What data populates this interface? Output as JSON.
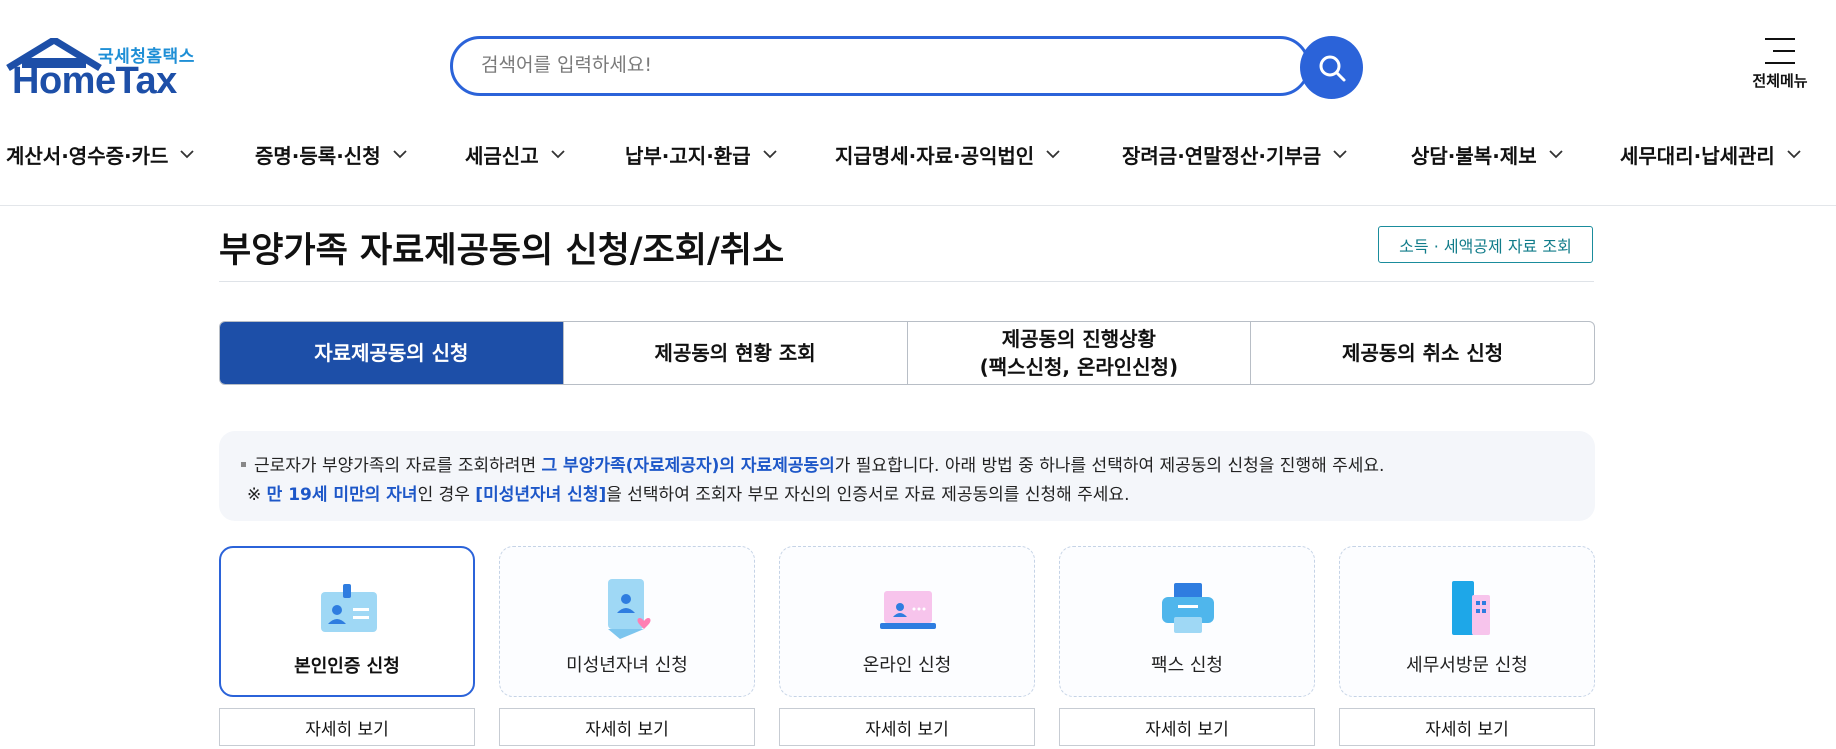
{
  "header": {
    "logo_ko": "국세청홈택스",
    "logo_en": "HomeTax",
    "search_placeholder": "검색어를 입력하세요!",
    "menu_label": "전체메뉴"
  },
  "gnb": [
    {
      "label": "계산서·영수증·카드"
    },
    {
      "label": "증명·등록·신청"
    },
    {
      "label": "세금신고"
    },
    {
      "label": "납부·고지·환급"
    },
    {
      "label": "지급명세·자료·공익법인"
    },
    {
      "label": "장려금·연말정산·기부금"
    },
    {
      "label": "상담·불복·제보"
    },
    {
      "label": "세무대리·납세관리"
    }
  ],
  "page": {
    "title": "부양가족 자료제공동의 신청/조회/취소",
    "side_link": "소득 · 세액공제 자료 조회"
  },
  "tabs": [
    {
      "label": "자료제공동의 신청"
    },
    {
      "label": "제공동의 현황 조회"
    },
    {
      "label": "제공동의 진행상황\n(팩스신청, 온라인신청)"
    },
    {
      "label": "제공동의 취소 신청"
    }
  ],
  "notice": {
    "l1_a": "근로자가 부양가족의 자료를 조회하려면 ",
    "l1_b": "그 부양가족(자료제공자)의 자료제공동의",
    "l1_c": "가 필요합니다. 아래 방법 중 하나를 선택하여 제공동의 신청을 진행해 주세요.",
    "l2_a": "※ ",
    "l2_b": "만 19세 미만의 자녀",
    "l2_c": "인 경우 ",
    "l2_d": "[미성년자녀 신청]",
    "l2_e": "을 선택하여 조회자 부모 자신의 인증서로 자료 제공동의를 신청해 주세요."
  },
  "methods": [
    {
      "label": "본인인증 신청",
      "detail": "자세히 보기",
      "icon": "id-card-icon"
    },
    {
      "label": "미성년자녀 신청",
      "detail": "자세히 보기",
      "icon": "child-heart-icon"
    },
    {
      "label": "온라인 신청",
      "detail": "자세히 보기",
      "icon": "laptop-icon"
    },
    {
      "label": "팩스 신청",
      "detail": "자세히 보기",
      "icon": "fax-icon"
    },
    {
      "label": "세무서방문 신청",
      "detail": "자세히 보기",
      "icon": "building-icon"
    }
  ],
  "colors": {
    "brand": "#1d4fa8",
    "accent": "#2b63d9",
    "teal": "#117c8a"
  }
}
